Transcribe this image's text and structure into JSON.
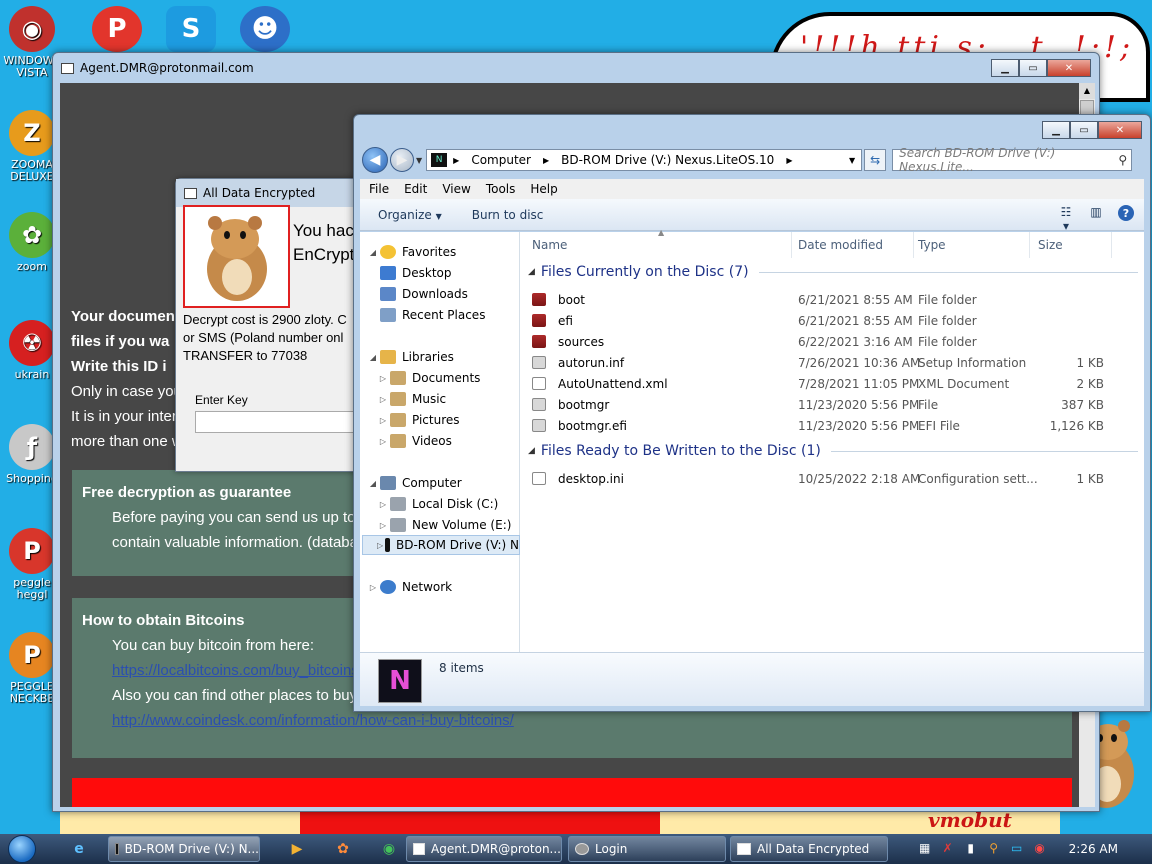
{
  "desktop": {
    "icons": [
      {
        "label": "WINDOWS VISTA",
        "glyph": "◉",
        "color": "#c0312d"
      },
      {
        "label": "ZOOMA DELUXE",
        "glyph": "Z",
        "color": "#e79b1c"
      },
      {
        "label": "zoom",
        "glyph": "✿",
        "color": "#5bb03a"
      },
      {
        "label": "ukrain",
        "glyph": "☢",
        "color": "#d62020"
      },
      {
        "label": "Shopping",
        "glyph": "ƒ",
        "color": "#c8c8c8"
      },
      {
        "label": "peggle heggl",
        "glyph": "P",
        "color": "#d8362b"
      },
      {
        "label": "PEGGLE NECKBE",
        "glyph": "P",
        "color": "#e68521"
      }
    ],
    "top_icons": [
      {
        "glyph": "P",
        "color": "#e2352c"
      },
      {
        "glyph": "S",
        "color": "#1d9be0"
      },
      {
        "glyph": "☻",
        "color": "#2d6fc8"
      }
    ],
    "cloud_text": "'!!!h.tti s:...t..!:!;",
    "bottom_text": "vmobut"
  },
  "ransom": {
    "title": "Agent.DMR@protonmail.com",
    "line1": "Your documen",
    "line2": "files if you wa",
    "line3": "Write this ID i",
    "line4": "Only in case you",
    "line5": "It is in your inter",
    "line6": "more than one w",
    "panel1": {
      "title": "Free decryption as guarantee",
      "p1": "Before paying you can send us up to",
      "p2": "contain valuable information. (databa"
    },
    "panel2": {
      "title": "How to obtain Bitcoins",
      "p1": "You can buy bitcoin from here:",
      "link1": "https://localbitcoins.com/buy_bitcoins",
      "p2": "Also you can find other places to buy",
      "link2": "http://www.coindesk.com/information/how-can-i-buy-bitcoins/"
    }
  },
  "encdlg": {
    "title": "All Data Encrypted",
    "head1": "You hac",
    "head2": "EnCrypt",
    "body1": "Decrypt cost is 2900 zloty. C",
    "body2": "or SMS (Poland number onl",
    "body3": "TRANSFER to 77038",
    "key_label": "Enter Key"
  },
  "explorer": {
    "address": {
      "crumb1": "Computer",
      "crumb2": "BD-ROM Drive (V:) Nexus.LiteOS.10"
    },
    "search_placeholder": "Search BD-ROM Drive (V:) Nexus.Lite...",
    "menu": [
      "File",
      "Edit",
      "View",
      "Tools",
      "Help"
    ],
    "commands": {
      "organize": "Organize",
      "burn": "Burn to disc"
    },
    "nav": {
      "favorites": "Favorites",
      "desktop": "Desktop",
      "downloads": "Downloads",
      "recent": "Recent Places",
      "libraries": "Libraries",
      "documents": "Documents",
      "music": "Music",
      "pictures": "Pictures",
      "videos": "Videos",
      "computer": "Computer",
      "local_disk": "Local Disk (C:)",
      "new_volume": "New Volume (E:)",
      "bd_rom": "BD-ROM Drive (V:) N",
      "network": "Network"
    },
    "columns": {
      "name": "Name",
      "date": "Date modified",
      "type": "Type",
      "size": "Size"
    },
    "group1": "Files Currently on the Disc (7)",
    "group2": "Files Ready to Be Written to the Disc (1)",
    "files_current": [
      {
        "name": "boot",
        "date": "6/21/2021 8:55 AM",
        "type": "File folder",
        "size": ""
      },
      {
        "name": "efi",
        "date": "6/21/2021 8:55 AM",
        "type": "File folder",
        "size": ""
      },
      {
        "name": "sources",
        "date": "6/22/2021 3:16 AM",
        "type": "File folder",
        "size": ""
      },
      {
        "name": "autorun.inf",
        "date": "7/26/2021 10:36 AM",
        "type": "Setup Information",
        "size": "1 KB"
      },
      {
        "name": "AutoUnattend.xml",
        "date": "7/28/2021 11:05 PM",
        "type": "XML Document",
        "size": "2 KB"
      },
      {
        "name": "bootmgr",
        "date": "11/23/2020 5:56 PM",
        "type": "File",
        "size": "387 KB"
      },
      {
        "name": "bootmgr.efi",
        "date": "11/23/2020 5:56 PM",
        "type": "EFI File",
        "size": "1,126 KB"
      }
    ],
    "files_pending": [
      {
        "name": "desktop.ini",
        "date": "10/25/2022 2:18 AM",
        "type": "Configuration sett...",
        "size": "1 KB"
      }
    ],
    "status": "8 items"
  },
  "taskbar": {
    "buttons": [
      "BD-ROM Drive (V:) N...",
      "Agent.DMR@proton...",
      "Login",
      "All Data Encrypted"
    ],
    "clock": "2:26 AM"
  }
}
